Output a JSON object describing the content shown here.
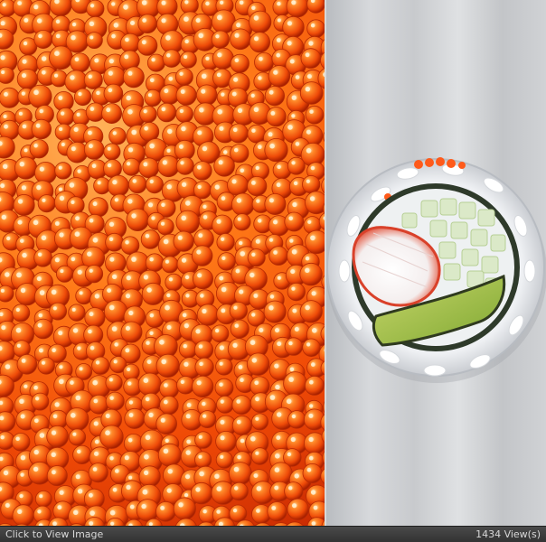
{
  "viewer": {
    "click_label": "Click to View Image",
    "view_count": "1434 View(s)"
  },
  "image": {
    "left_subject": "red caviar",
    "right_subject": "sushi roll"
  },
  "colors": {
    "caviar_orange": "#ff6a10",
    "caviar_highlight": "#ffd08a",
    "background_gray": "#d0d2d5",
    "status_bar": "#3a3a3a",
    "status_text": "#d8d8d8"
  }
}
